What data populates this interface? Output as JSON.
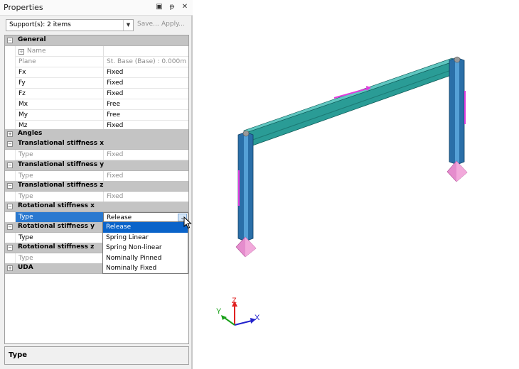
{
  "panel": {
    "title": "Properties",
    "buttons": [
      "▣",
      "ᵽ",
      "✕"
    ],
    "selector_value": "Support(s): 2 items",
    "save_label": "Save...",
    "apply_label": "Apply..."
  },
  "grid": {
    "general": {
      "label": "General",
      "rows": [
        {
          "name": "Name",
          "value": ""
        },
        {
          "name": "Plane",
          "value": "St. Base (Base) : 0.000m"
        },
        {
          "name": "Fx",
          "value": "Fixed"
        },
        {
          "name": "Fy",
          "value": "Fixed"
        },
        {
          "name": "Fz",
          "value": "Fixed"
        },
        {
          "name": "Mx",
          "value": "Free"
        },
        {
          "name": "My",
          "value": "Free"
        },
        {
          "name": "Mz",
          "value": "Fixed"
        }
      ]
    },
    "angles": {
      "label": "Angles"
    },
    "trans_x": {
      "label": "Translational stiffness x",
      "type_name": "Type",
      "type_value": "Fixed"
    },
    "trans_y": {
      "label": "Translational stiffness y",
      "type_name": "Type",
      "type_value": "Fixed"
    },
    "trans_z": {
      "label": "Translational stiffness z",
      "type_name": "Type",
      "type_value": "Fixed"
    },
    "rot_x": {
      "label": "Rotational stiffness x",
      "type_name": "Type",
      "type_value": "Release"
    },
    "rot_y": {
      "label": "Rotational stiffness y",
      "type_name": "Type"
    },
    "rot_z": {
      "label": "Rotational stiffness z",
      "type_name": "Type"
    },
    "uda": {
      "label": "UDA"
    }
  },
  "dropdown": {
    "options": [
      "Release",
      "Spring Linear",
      "Spring Non-linear",
      "Nominally Pinned",
      "Nominally Fixed"
    ],
    "selected": "Release"
  },
  "description": {
    "title": "Type"
  },
  "axes": {
    "x": "X",
    "y": "Y",
    "z": "Z"
  },
  "colors": {
    "accent": "#0a63c9",
    "beam_teal": "#1f8f8a",
    "column_blue": "#2a6fa8",
    "support_pink": "#e58ccd",
    "load_magenta": "#e23cdc"
  }
}
